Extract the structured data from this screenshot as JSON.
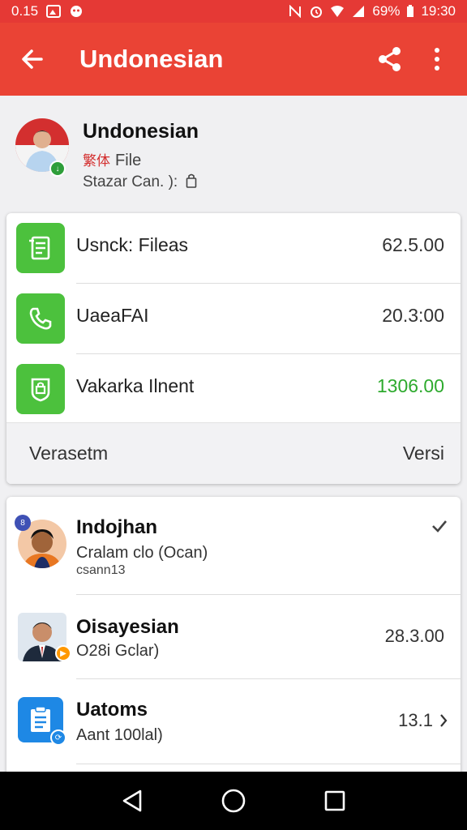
{
  "status_bar": {
    "time_left": "0.15",
    "battery": "69%",
    "clock": "19:30"
  },
  "app_bar": {
    "title": "Undonesian"
  },
  "profile": {
    "name": "Undonesian",
    "zh_label": "繁体",
    "file_label": "File",
    "status": "Stazar Can. ):"
  },
  "summary_rows": [
    {
      "label": "Usnck: Fileas",
      "value": "62.5.00",
      "icon": "document-icon"
    },
    {
      "label": "UaeaFAI",
      "value": "20.3:00",
      "icon": "phone-icon"
    },
    {
      "label": "Vakarka Ilnent",
      "value": "1306.00",
      "icon": "shield-icon"
    }
  ],
  "summary_footer": {
    "left": "Verasetm",
    "right": "Versi"
  },
  "contacts": [
    {
      "name": "Indojhan",
      "sub": "Cralam clo (Ocan)",
      "sub2": "csann13",
      "amount": ""
    },
    {
      "name": "Oisayesian",
      "sub": "O28i Gclar)",
      "sub2": "",
      "amount": "28.3.00"
    },
    {
      "name": "Uatoms",
      "sub": "Aant 100lal)",
      "sub2": "",
      "amount": "13.1"
    }
  ],
  "colors": {
    "accent": "#ea4335",
    "green": "#4cc13d",
    "blue": "#1e88e5"
  }
}
